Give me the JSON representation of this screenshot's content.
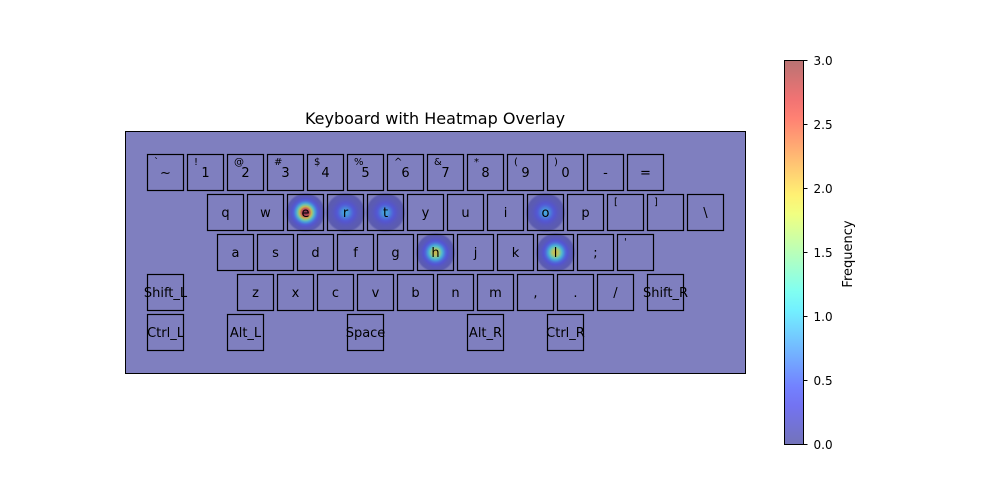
{
  "chart_data": {
    "type": "heatmap",
    "title": "Keyboard with Heatmap Overlay",
    "colorbar": {
      "label": "Frequency",
      "range": [
        0,
        3
      ],
      "ticks": [
        "0.0",
        "0.5",
        "1.0",
        "1.5",
        "2.0",
        "2.5",
        "3.0"
      ],
      "colormap": "jet",
      "alpha": 0.5
    },
    "keyboard": {
      "rows": [
        [
          {
            "label": "~",
            "shift": "`"
          },
          {
            "label": "1",
            "shift": "!"
          },
          {
            "label": "2",
            "shift": "@"
          },
          {
            "label": "3",
            "shift": "#"
          },
          {
            "label": "4",
            "shift": "$"
          },
          {
            "label": "5",
            "shift": "%"
          },
          {
            "label": "6",
            "shift": "^"
          },
          {
            "label": "7",
            "shift": "&"
          },
          {
            "label": "8",
            "shift": "*"
          },
          {
            "label": "9",
            "shift": "("
          },
          {
            "label": "0",
            "shift": ")"
          },
          {
            "label": "-",
            "shift": ""
          },
          {
            "label": "=",
            "shift": ""
          }
        ],
        [
          {
            "label": "q",
            "shift": ""
          },
          {
            "label": "w",
            "shift": ""
          },
          {
            "label": "e",
            "shift": ""
          },
          {
            "label": "r",
            "shift": ""
          },
          {
            "label": "t",
            "shift": ""
          },
          {
            "label": "y",
            "shift": ""
          },
          {
            "label": "u",
            "shift": ""
          },
          {
            "label": "i",
            "shift": ""
          },
          {
            "label": "o",
            "shift": ""
          },
          {
            "label": "p",
            "shift": ""
          },
          {
            "label": "",
            "shift": "["
          },
          {
            "label": "",
            "shift": "]"
          },
          {
            "label": "\\",
            "shift": ""
          }
        ],
        [
          {
            "label": "a",
            "shift": ""
          },
          {
            "label": "s",
            "shift": ""
          },
          {
            "label": "d",
            "shift": ""
          },
          {
            "label": "f",
            "shift": ""
          },
          {
            "label": "g",
            "shift": ""
          },
          {
            "label": "h",
            "shift": ""
          },
          {
            "label": "j",
            "shift": ""
          },
          {
            "label": "k",
            "shift": ""
          },
          {
            "label": "l",
            "shift": ""
          },
          {
            "label": ";",
            "shift": ""
          },
          {
            "label": "",
            "shift": "'"
          }
        ],
        [
          {
            "label": "Shift_L",
            "shift": ""
          },
          {
            "label": "z",
            "shift": ""
          },
          {
            "label": "x",
            "shift": ""
          },
          {
            "label": "c",
            "shift": ""
          },
          {
            "label": "v",
            "shift": ""
          },
          {
            "label": "b",
            "shift": ""
          },
          {
            "label": "n",
            "shift": ""
          },
          {
            "label": "m",
            "shift": ""
          },
          {
            "label": ",",
            "shift": ""
          },
          {
            "label": ".",
            "shift": ""
          },
          {
            "label": "/",
            "shift": ""
          },
          {
            "label": "Shift_R",
            "shift": ""
          }
        ],
        [
          {
            "label": "Ctrl_L",
            "shift": ""
          },
          {
            "label": "Alt_L",
            "shift": ""
          },
          {
            "label": "Space",
            "shift": ""
          },
          {
            "label": "Alt_R",
            "shift": ""
          },
          {
            "label": "Ctrl_R",
            "shift": ""
          }
        ]
      ]
    },
    "hotspots": [
      {
        "key": "e",
        "frequency": 3.0
      },
      {
        "key": "r",
        "frequency": 1.0
      },
      {
        "key": "t",
        "frequency": 1.0
      },
      {
        "key": "o",
        "frequency": 1.0
      },
      {
        "key": "h",
        "frequency": 2.0
      },
      {
        "key": "l",
        "frequency": 2.0
      }
    ],
    "background_color": "#7f7fbf",
    "key_border_color": "#000000"
  }
}
